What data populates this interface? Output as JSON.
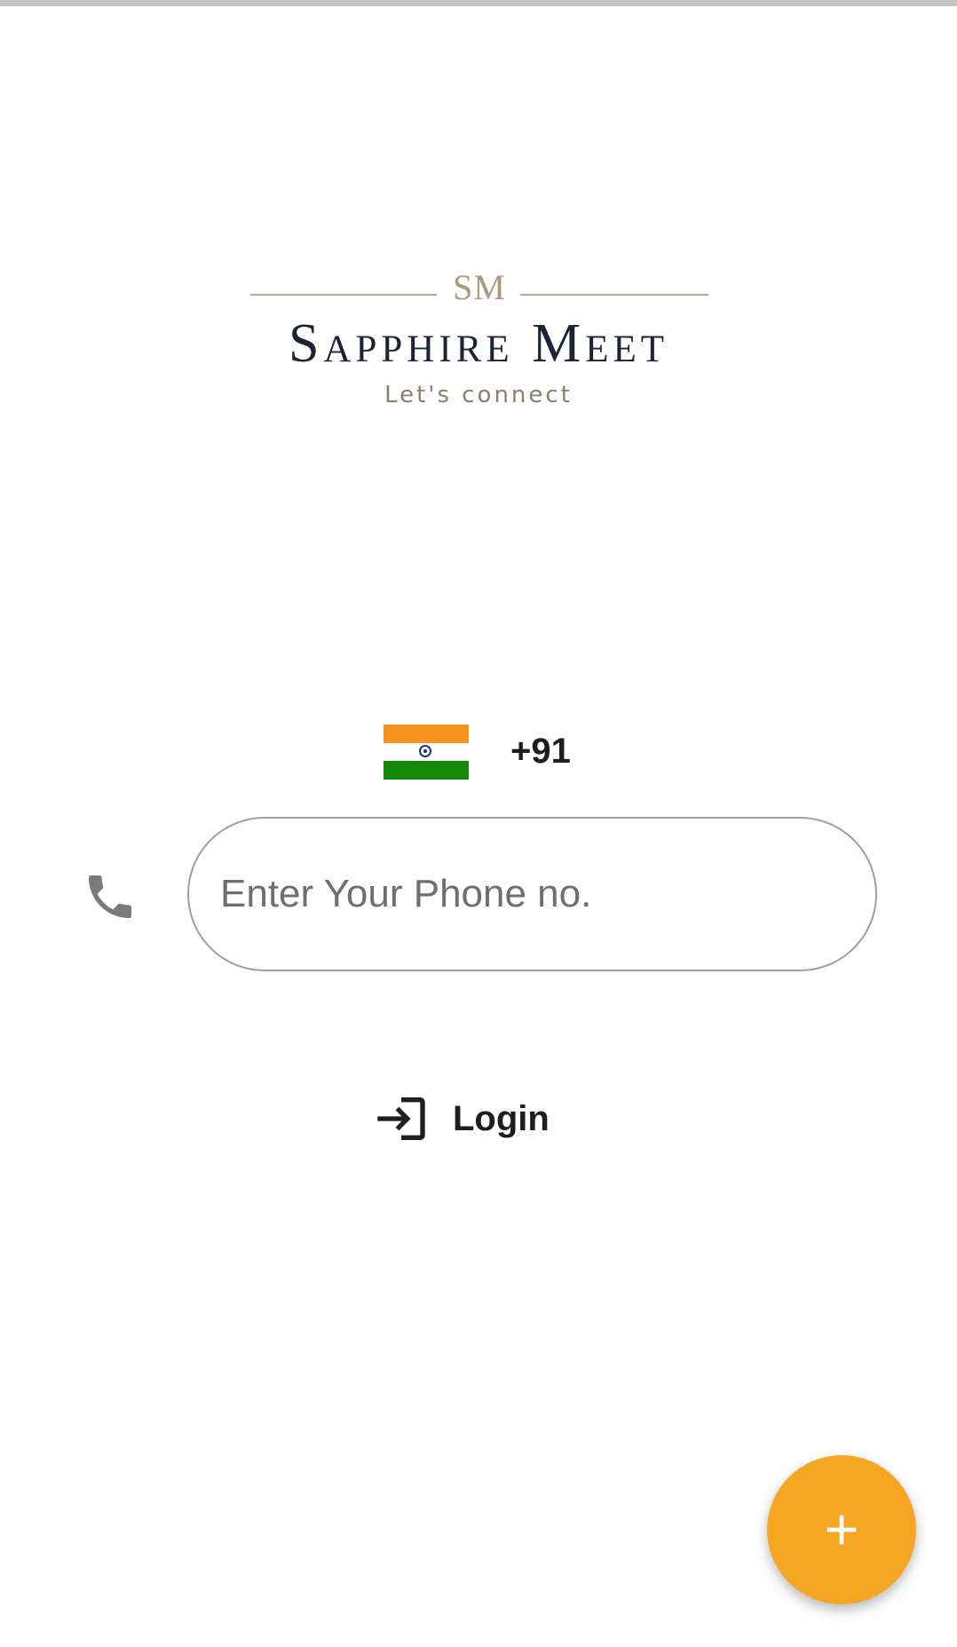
{
  "app": {
    "logo": {
      "monogram": "SM",
      "name": "Sapphire Meet",
      "tagline": "Let's connect"
    }
  },
  "country": {
    "flag": "india-flag",
    "dial_code": "+91"
  },
  "phone": {
    "icon": "phone-icon",
    "value": "",
    "placeholder": "Enter Your Phone no."
  },
  "login": {
    "icon": "login-icon",
    "label": "Login"
  },
  "fab": {
    "icon": "plus-icon",
    "color": "#f5a623"
  },
  "colors": {
    "accent": "#f5a623",
    "logo_gold": "#a89a7e",
    "logo_navy": "#1d2334"
  }
}
